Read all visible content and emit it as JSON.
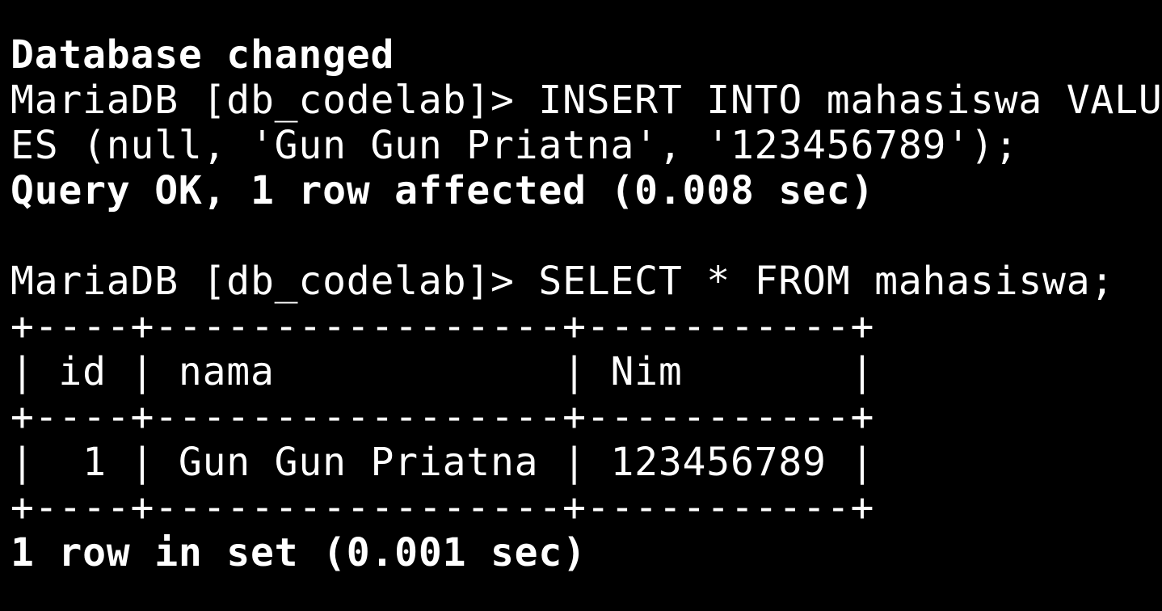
{
  "terminal": {
    "background_color": "#000000",
    "text_color": "#ffffff",
    "lines": [
      "Database changed",
      "MariaDB [db_codelab]> INSERT INTO mahasiswa VALU",
      "ES (null, 'Gun Gun Priatna', '123456789');",
      "Query OK, 1 row affected (0.008 sec)",
      "",
      "MariaDB [db_codelab]> SELECT * FROM mahasiswa;",
      "+----+-----------------+-----------+",
      "| id | nama            | Nim       |",
      "+----+-----------------+-----------+",
      "|  1 | Gun Gun Priatna | 123456789 |",
      "+----+-----------------+-----------+",
      "1 row in set (0.001 sec)"
    ]
  }
}
